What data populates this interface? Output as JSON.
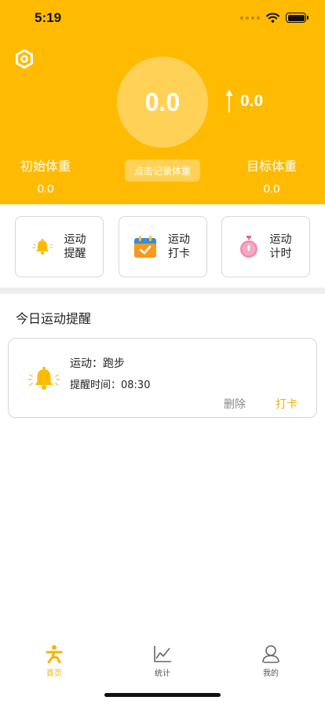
{
  "status_bar": {
    "time": "5:19"
  },
  "header": {
    "current_weight": "0.0",
    "change_value": "0.0",
    "record_button": "点击记录体重",
    "initial": {
      "label": "初始体重",
      "value": "0.0"
    },
    "target": {
      "label": "目标体重",
      "value": "0.0"
    }
  },
  "actions": [
    {
      "label": "运动提醒",
      "icon": "bell-icon"
    },
    {
      "label": "运动打卡",
      "icon": "calendar-check-icon"
    },
    {
      "label": "运动计时",
      "icon": "stopwatch-icon"
    }
  ],
  "section": {
    "title": "今日运动提醒"
  },
  "reminder": {
    "sport": "运动：跑步",
    "time": "提醒时间：08:30",
    "delete_label": "删除",
    "checkin_label": "打卡"
  },
  "tabs": [
    {
      "label": "首页",
      "icon": "exercise-person-icon",
      "active": true
    },
    {
      "label": "统计",
      "icon": "line-chart-icon",
      "active": false
    },
    {
      "label": "我的",
      "icon": "user-icon",
      "active": false
    }
  ],
  "colors": {
    "brand": "#FFBB02",
    "accent": "#F5B400"
  }
}
